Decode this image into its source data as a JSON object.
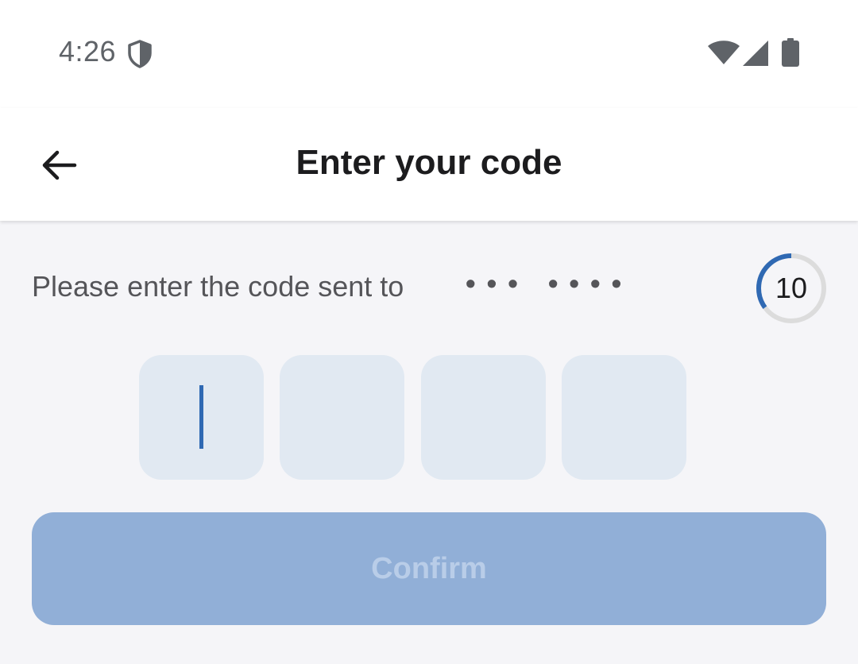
{
  "status_bar": {
    "time": "4:26",
    "icons": [
      "shield-icon",
      "wifi-icon",
      "signal-icon",
      "battery-icon"
    ]
  },
  "app_bar": {
    "back_icon": "arrow-left-icon",
    "title": "Enter your code"
  },
  "prompt": {
    "text": "Please enter the code sent to",
    "masked_phone": "••• ••••"
  },
  "timer": {
    "seconds_label": "10",
    "remaining_fraction": 0.35,
    "accent_color": "#2f69b3",
    "track_color": "#dcdcdc"
  },
  "code_input": {
    "length": 4,
    "values": [
      "",
      "",
      "",
      ""
    ],
    "active_index": 0
  },
  "confirm_button": {
    "label": "Confirm",
    "enabled": false
  },
  "colors": {
    "accent": "#2f69b3",
    "box_fill": "#e1e9f2",
    "button_disabled": "#91afd7",
    "background": "#f5f5f8"
  }
}
